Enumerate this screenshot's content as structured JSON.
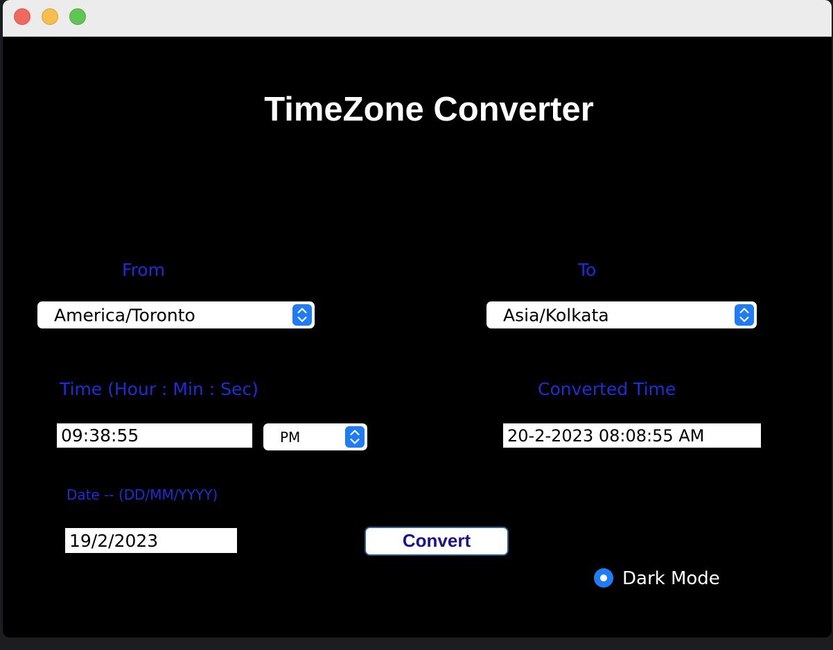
{
  "title": "TimeZone Converter",
  "colors": {
    "background": "#000000",
    "label_blue": "#1a2fd8",
    "button_text": "#1a1290",
    "accent": "#1f7cf5",
    "title_text": "#ffffff"
  },
  "from": {
    "label": "From",
    "selected": "America/Toronto",
    "icon": "chevron-updown-icon"
  },
  "to": {
    "label": "To",
    "selected": "Asia/Kolkata",
    "icon": "chevron-updown-icon"
  },
  "time": {
    "label": "Time (Hour : Min : Sec)",
    "value": "09:38:55",
    "ampm": "PM"
  },
  "converted": {
    "label": "Converted Time",
    "value": "20-2-2023 08:08:55 AM"
  },
  "date": {
    "label": "Date -- (DD/MM/YYYY)",
    "value": "19/2/2023"
  },
  "convert_button": {
    "label": "Convert"
  },
  "dark_mode": {
    "label": "Dark Mode",
    "checked": true
  }
}
